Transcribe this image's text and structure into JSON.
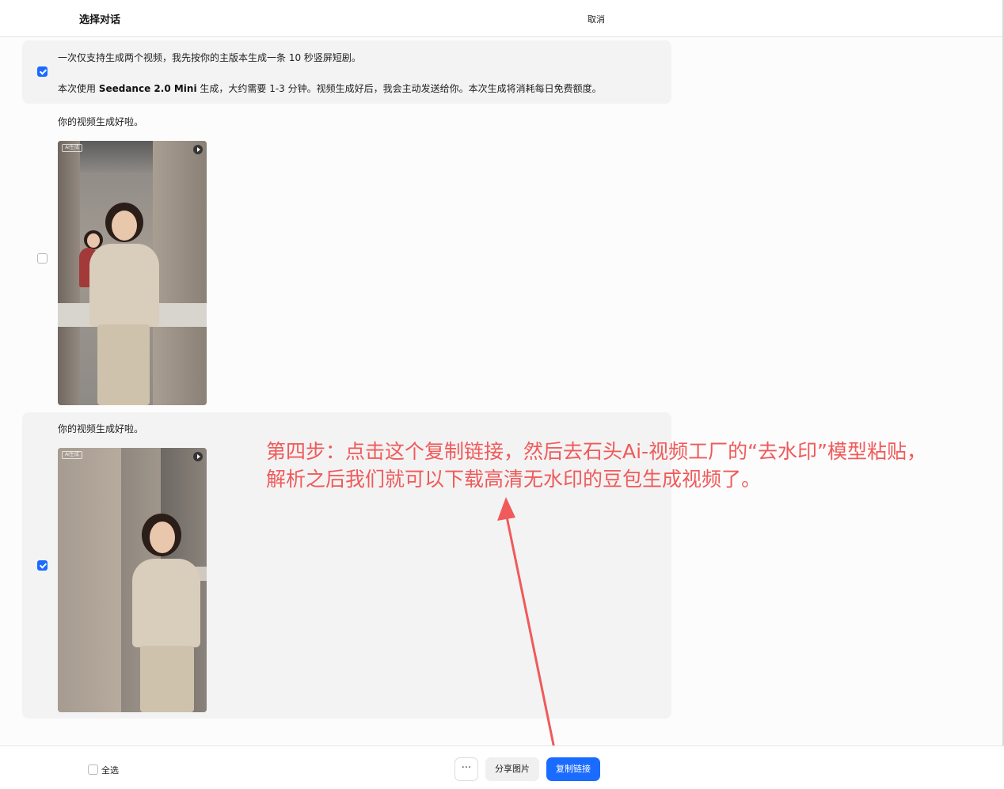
{
  "header": {
    "title": "选择对话",
    "cancel_label": "取消"
  },
  "messages": [
    {
      "checked": true,
      "line1": "一次仅支持生成两个视频，我先按你的主版本生成一条 10 秒竖屏短剧。",
      "line2_prefix": "本次使用 ",
      "line2_model": "Seedance 2.0 Mini",
      "line2_suffix": " 生成，大约需要 1-3 分钟。视频生成好后，我会主动发送给你。本次生成将消耗每日免费额度。"
    },
    {
      "checked": false,
      "text": "你的视频生成好啦。",
      "video_badge": "AI生成"
    },
    {
      "checked": true,
      "text": "你的视频生成好啦。",
      "video_badge": "AI生成"
    }
  ],
  "annotation": {
    "line1": "第四步：点击这个复制链接，然后去石头Ai-视频工厂的“去水印”模型粘贴，",
    "line2": "解析之后我们就可以下载高清无水印的豆包生成视频了。",
    "color": "#f05a5a"
  },
  "footer": {
    "select_all_label": "全选",
    "more_label": "···",
    "share_label": "分享图片",
    "copy_label": "复制链接"
  },
  "colors": {
    "accent": "#1a6bff",
    "selected_bg": "#f3f3f3"
  }
}
